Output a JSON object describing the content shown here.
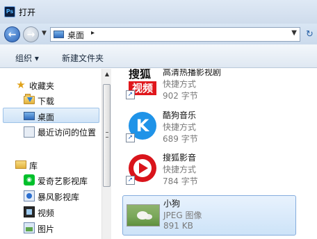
{
  "window": {
    "title": "打开",
    "app_icon_text": "Ps"
  },
  "address": {
    "location": "桌面",
    "separator": "▸"
  },
  "toolbar": {
    "organize": "组织 ▾",
    "new_folder": "新建文件夹"
  },
  "nav": {
    "favorites_header": "收藏夹",
    "favorites": [
      {
        "label": "下载",
        "icon": "download-folder-icon"
      },
      {
        "label": "桌面",
        "icon": "desktop-icon"
      },
      {
        "label": "最近访问的位置",
        "icon": "recent-places-icon"
      }
    ],
    "libraries_header": "库",
    "libraries": [
      {
        "label": "爱奇艺影视库",
        "icon": "aiqiyi-icon"
      },
      {
        "label": "暴风影视库",
        "icon": "baofeng-icon"
      },
      {
        "label": "视频",
        "icon": "video-library-icon"
      },
      {
        "label": "图片",
        "icon": "picture-library-icon"
      }
    ]
  },
  "files": [
    {
      "name": "高清热播影视剧",
      "type": "快捷方式",
      "size": "902 字节",
      "logo_top": "搜狐",
      "logo_bottom": "视频"
    },
    {
      "name": "酷狗音乐",
      "type": "快捷方式",
      "size": "689 字节",
      "logo": "K"
    },
    {
      "name": "搜狐影音",
      "type": "快捷方式",
      "size": "784 字节"
    },
    {
      "name": "小狗",
      "type": "JPEG 图像",
      "size": "891 KB"
    }
  ],
  "colors": {
    "accent": "#2a63b7",
    "selection_border": "#84acdd",
    "selection_fill": "#cde3f8"
  }
}
